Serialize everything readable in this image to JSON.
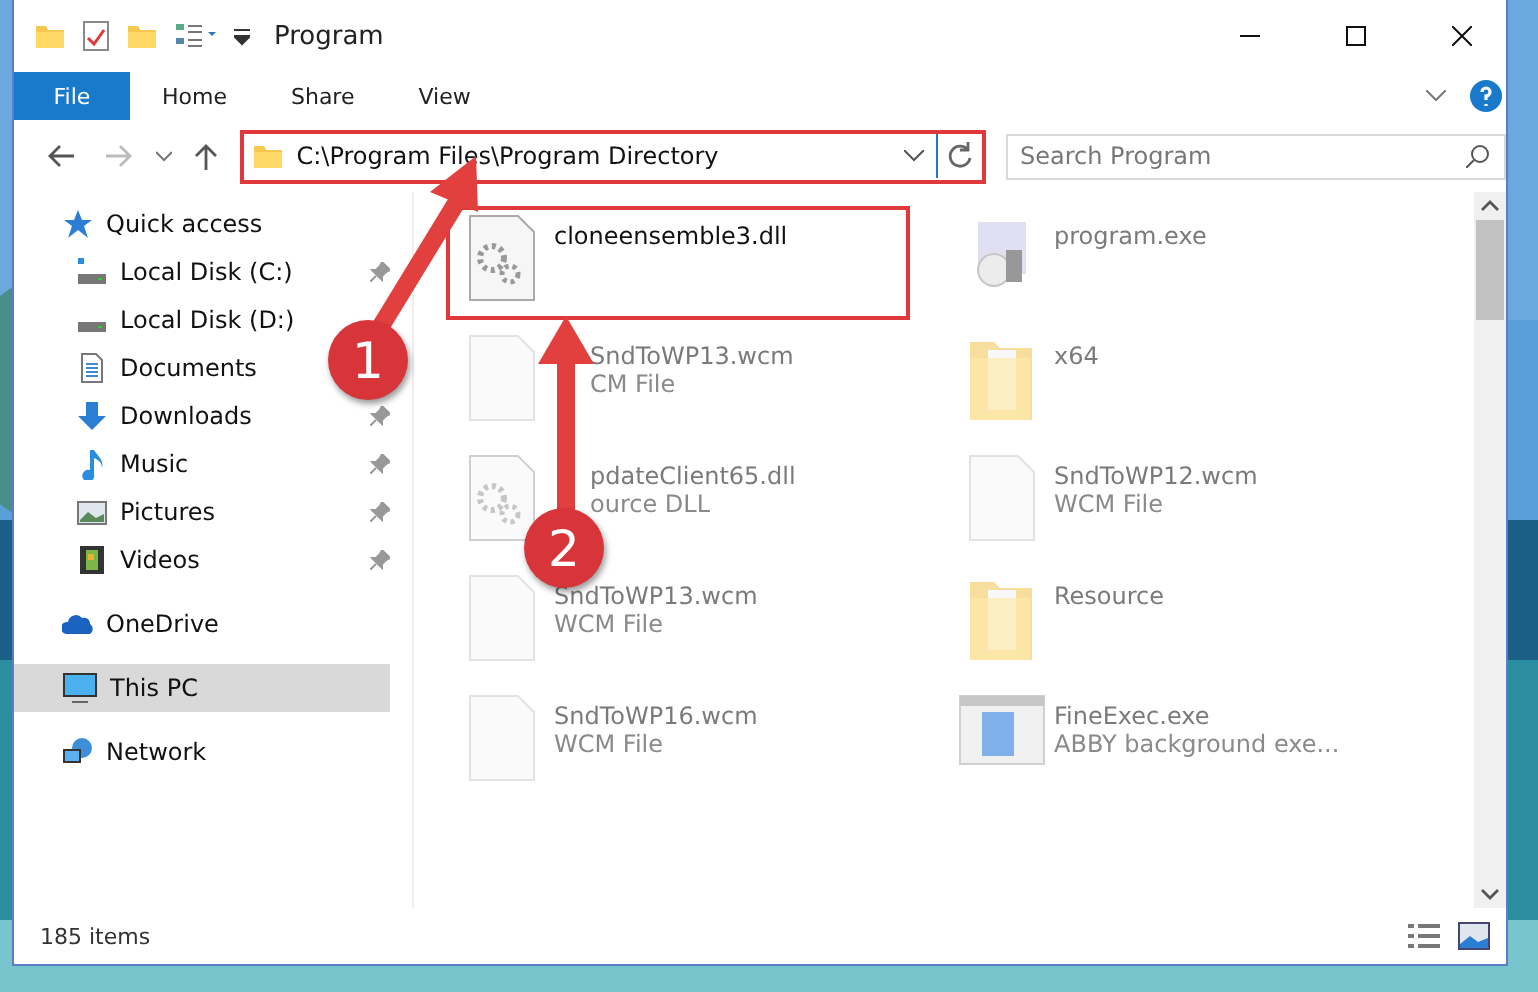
{
  "window": {
    "title": "Program"
  },
  "ribbon": {
    "tabs": [
      {
        "label": "File",
        "kind": "file"
      },
      {
        "label": "Home",
        "kind": "tab"
      },
      {
        "label": "Share",
        "kind": "tab"
      },
      {
        "label": "View",
        "kind": "tab"
      }
    ]
  },
  "address_bar": {
    "path": "C:\\Program Files\\Program Directory",
    "highlighted": true
  },
  "search": {
    "placeholder": "Search Program"
  },
  "nav": [
    {
      "label": "Quick access",
      "selected": false,
      "children": [
        {
          "label": "Local Disk (C:)",
          "selected": false,
          "pinned": true
        },
        {
          "label": "Local Disk (D:)",
          "selected": false
        },
        {
          "label": "Documents",
          "selected": false
        },
        {
          "label": "Downloads",
          "selected": false,
          "pinned": true
        },
        {
          "label": "Music",
          "selected": false,
          "pinned": true
        },
        {
          "label": "Pictures",
          "selected": false,
          "pinned": true
        },
        {
          "label": "Videos",
          "selected": false,
          "pinned": true
        }
      ]
    },
    {
      "label": "OneDrive",
      "selected": false
    },
    {
      "label": "This PC",
      "selected": true
    },
    {
      "label": "Network",
      "selected": false
    }
  ],
  "files": [
    {
      "name": "cloneensemble3.dll",
      "kind": "dll",
      "highlighted": true,
      "blurred": false
    },
    {
      "name": "program.exe",
      "kind": "program",
      "highlighted": false,
      "blurred": true
    },
    {
      "name": "SndToWP13.wcm",
      "description": "CM File",
      "kind": "document",
      "highlighted": false,
      "blurred": true
    },
    {
      "name": "x64",
      "kind": "folder",
      "highlighted": false,
      "blurred": true
    },
    {
      "name": "pdateClient65.dll",
      "description": "ource DLL",
      "kind": "dll",
      "highlighted": false,
      "blurred": true
    },
    {
      "name": "SndToWP12.wcm",
      "description": "WCM File",
      "kind": "document",
      "highlighted": false,
      "blurred": true
    },
    {
      "name": "SndToWP13.wcm",
      "description": "WCM File",
      "kind": "document",
      "highlighted": false,
      "blurred": true
    },
    {
      "name": "Resource",
      "kind": "folder",
      "highlighted": false,
      "blurred": true
    },
    {
      "name": "SndToWP16.wcm",
      "description": "WCM File",
      "kind": "document",
      "highlighted": false,
      "blurred": true
    },
    {
      "name": "FineExec.exe",
      "description": "ABBY background exe...",
      "kind": "application",
      "highlighted": false,
      "blurred": true
    }
  ],
  "annotations": [
    {
      "label": "1",
      "kind": "diagonal"
    },
    {
      "label": "2",
      "kind": "vertical"
    }
  ],
  "status_bar": {
    "item_count": "185 items"
  }
}
